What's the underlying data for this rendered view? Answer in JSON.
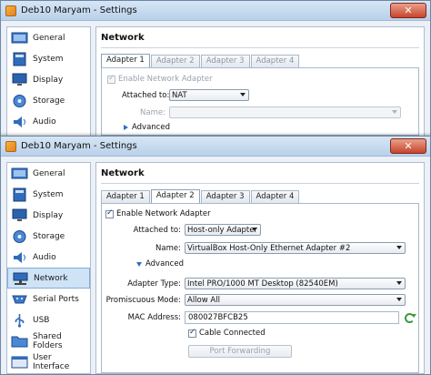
{
  "back_window": {
    "title": "Deb10 Maryam - Settings",
    "sidebar": [
      "General",
      "System",
      "Display",
      "Storage",
      "Audio"
    ],
    "section_title": "Network",
    "tabs": [
      "Adapter 1",
      "Adapter 2",
      "Adapter 3",
      "Adapter 4"
    ],
    "enable_label": "Enable Network Adapter",
    "attached_label": "Attached to:",
    "attached_value": "NAT",
    "name_label": "Name:",
    "advanced_label": "Advanced"
  },
  "front_window": {
    "title": "Deb10 Maryam - Settings",
    "sidebar": [
      "General",
      "System",
      "Display",
      "Storage",
      "Audio",
      "Network",
      "Serial Ports",
      "USB",
      "Shared Folders",
      "User Interface"
    ],
    "selected_sidebar": "Network",
    "section_title": "Network",
    "tabs": [
      "Adapter 1",
      "Adapter 2",
      "Adapter 3",
      "Adapter 4"
    ],
    "active_tab": "Adapter 2",
    "enable_label": "Enable Network Adapter",
    "attached_label": "Attached to:",
    "attached_value": "Host-only Adapter",
    "name_label": "Name:",
    "name_value": "VirtualBox Host-Only Ethernet Adapter #2",
    "advanced_label": "Advanced",
    "adapter_type_label": "Adapter Type:",
    "adapter_type_value": "Intel PRO/1000 MT Desktop (82540EM)",
    "promiscuous_label": "Promiscuous Mode:",
    "promiscuous_value": "Allow All",
    "mac_label": "MAC Address:",
    "mac_value": "080027BFCB25",
    "cable_label": "Cable Connected",
    "port_forwarding_label": "Port Forwarding"
  },
  "icons": {
    "app": "virtualbox-icon",
    "close": "close-icon",
    "refresh": "refresh-mac-icon"
  }
}
